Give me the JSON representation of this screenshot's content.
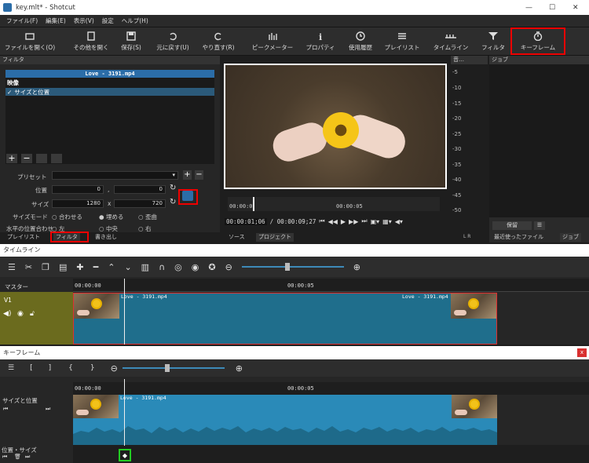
{
  "window": {
    "title": "key.mlt* - Shotcut",
    "controls": [
      "—",
      "☐",
      "✕"
    ]
  },
  "menu": [
    "ファイル(F)",
    "編集(E)",
    "表示(V)",
    "設定",
    "ヘルプ(H)"
  ],
  "toolbar": {
    "open": "ファイルを開く(O)",
    "open_other": "その他を開く",
    "save": "保存(S)",
    "undo": "元に戻す(U)",
    "redo": "やり直す(R)",
    "peak": "ピークメーター",
    "properties": "プロパティ",
    "history": "使用履歴",
    "playlist": "プレイリスト",
    "timeline": "タイムライン",
    "filters": "フィルタ",
    "keyframes": "キーフレーム"
  },
  "filters_panel": {
    "title": "フィルタ",
    "clip_name": "Love - 3191.mp4",
    "section": "映像",
    "filter_item": "サイズと位置",
    "filter_check": "✓",
    "preset_label": "プリセット",
    "position_label": "位置",
    "size_label": "サイズ",
    "pos_x": "0",
    "pos_y": "0",
    "size_w": "1280",
    "size_h": "720",
    "sep_comma": ",",
    "sep_x": "x",
    "size_mode_label": "サイズモード",
    "mode_fit": "合わせる",
    "mode_fill": "埋める",
    "mode_distort": "歪曲",
    "hover_text": "水平の位置合わせ",
    "align_left": "左",
    "align_center": "中央",
    "align_right": "右"
  },
  "left_tabs": [
    "プレイリスト",
    "フィルタ",
    "書き出し"
  ],
  "player": {
    "timecode_current": "00:00:01;06",
    "timecode_total": "/ 00:00:09;27",
    "ruler": [
      "00:00:0",
      "00:00:05"
    ],
    "tabs": [
      "ソース",
      "プロジェクト"
    ]
  },
  "audio": {
    "title": "音…",
    "scale": [
      "-5",
      "-10",
      "-15",
      "-20",
      "-25",
      "-30",
      "-35",
      "-40",
      "-45",
      "-50"
    ],
    "lr": "L  R"
  },
  "jobs": {
    "title": "ジョブ",
    "pause": "保留",
    "menu": "☰",
    "tabs": [
      "最近使ったファイル",
      "ジョブ"
    ]
  },
  "timeline": {
    "title": "タイムライン",
    "master": "マスター",
    "track": "V1",
    "ruler": [
      "00:00:00",
      "00:00:05"
    ],
    "clip_name": "Love - 3191.mp4"
  },
  "keyframes": {
    "title": "キーフレーム",
    "close": "x",
    "brackets": [
      "[",
      "]",
      "{",
      "}"
    ],
    "ruler": [
      "00:00:00",
      "00:00:05"
    ],
    "filter_track": "サイズと位置",
    "param_track": "位置・サイズ",
    "clip_name": "Love - 3191.mp4"
  },
  "colors": {
    "accent": "#3d8ab8",
    "highlight_red": "#e00000",
    "keyframe_green": "#22cc22",
    "track_olive": "#6b6b1e",
    "clip_teal": "#1f6e8c"
  }
}
